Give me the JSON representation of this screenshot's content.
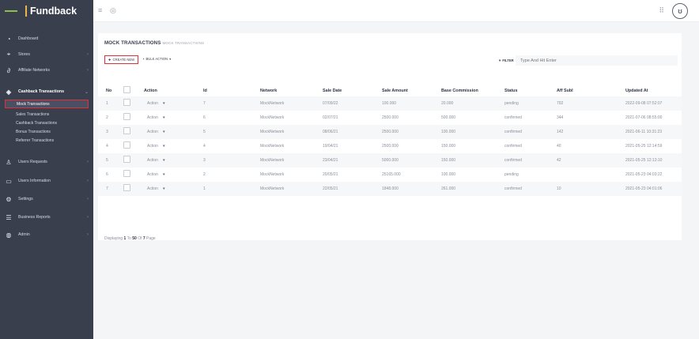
{
  "app": {
    "name": "Fundback"
  },
  "sidebar": {
    "items": [
      {
        "label": "Dashboard",
        "icon": "dashboard-icon"
      },
      {
        "label": "Stores",
        "icon": "tag-icon"
      },
      {
        "label": "Affiliate Networks",
        "icon": "link-icon"
      },
      {
        "label": "Cashback Transactions",
        "icon": "layers-icon"
      },
      {
        "label": "Users Requests",
        "icon": "user-icon"
      },
      {
        "label": "Users Information",
        "icon": "window-icon"
      },
      {
        "label": "Settings",
        "icon": "gear-icon"
      },
      {
        "label": "Business Reports",
        "icon": "list-icon"
      },
      {
        "label": "Admin",
        "icon": "admin-icon"
      }
    ],
    "submenu": [
      {
        "label": "Mock Transactions",
        "active": true
      },
      {
        "label": "Sales Transactions"
      },
      {
        "label": "Cashback Transactions"
      },
      {
        "label": "Bonus Transactions"
      },
      {
        "label": "Referrer Transactions"
      }
    ]
  },
  "page": {
    "title": "MOCK TRANSACTIONS",
    "breadcrumb": "MOCK TRANSACTIONS",
    "create_label": "CREATE NEW",
    "bulk_label": "BULK ACTION",
    "filter_label": "FILTER",
    "filter_placeholder": "Type And Hit Enter"
  },
  "table": {
    "headers": [
      "No",
      "Action",
      "Id",
      "Network",
      "Sale Date",
      "Sale Amount",
      "Base Commission",
      "Status",
      "Aff Subl",
      "Updated At"
    ],
    "rows": [
      {
        "no": "1",
        "action": "Action",
        "id": "7",
        "network": "MockNetwork",
        "sale_date": "07/09/22",
        "sale_amount": "100.000",
        "base_commission": "20.000",
        "status": "pending",
        "aff_sub": "792",
        "updated_at": "2022-09-08 07:52:07"
      },
      {
        "no": "2",
        "action": "Action",
        "id": "6",
        "network": "MockNetwork",
        "sale_date": "02/07/21",
        "sale_amount": "2500.000",
        "base_commission": "500.000",
        "status": "confirmed",
        "aff_sub": "344",
        "updated_at": "2021-07-06 08:55:00"
      },
      {
        "no": "3",
        "action": "Action",
        "id": "5",
        "network": "MockNetwork",
        "sale_date": "08/06/21",
        "sale_amount": "2500.000",
        "base_commission": "100.000",
        "status": "confirmed",
        "aff_sub": "142",
        "updated_at": "2021-06-11 10:31:23"
      },
      {
        "no": "4",
        "action": "Action",
        "id": "4",
        "network": "MockNetwork",
        "sale_date": "19/04/21",
        "sale_amount": "2500.000",
        "base_commission": "150.000",
        "status": "confirmed",
        "aff_sub": "40",
        "updated_at": "2021-05-25 12:14:59"
      },
      {
        "no": "5",
        "action": "Action",
        "id": "3",
        "network": "MockNetwork",
        "sale_date": "23/04/21",
        "sale_amount": "5000.000",
        "base_commission": "150.000",
        "status": "confirmed",
        "aff_sub": "42",
        "updated_at": "2021-05-25 12:13:10"
      },
      {
        "no": "6",
        "action": "Action",
        "id": "2",
        "network": "MockNetwork",
        "sale_date": "20/05/21",
        "sale_amount": "25165.000",
        "base_commission": "100.000",
        "status": "pending",
        "aff_sub": "",
        "updated_at": "2021-05-23 04:03:22"
      },
      {
        "no": "7",
        "action": "Action",
        "id": "1",
        "network": "MockNetwork",
        "sale_date": "22/05/21",
        "sale_amount": "1848.000",
        "base_commission": "261.000",
        "status": "confirmed",
        "aff_sub": "10",
        "updated_at": "2021-05-23 04:01:06"
      }
    ]
  },
  "pager": {
    "prefix": "Displaying",
    "from": "1",
    "to_word": "To",
    "to": "50",
    "of_word": "Of",
    "total": "7",
    "suffix": "Page"
  },
  "colors": {
    "sidebar": "#3a3f4e",
    "accent_red": "#e0303a",
    "logo_green": "#8fbf4a"
  }
}
